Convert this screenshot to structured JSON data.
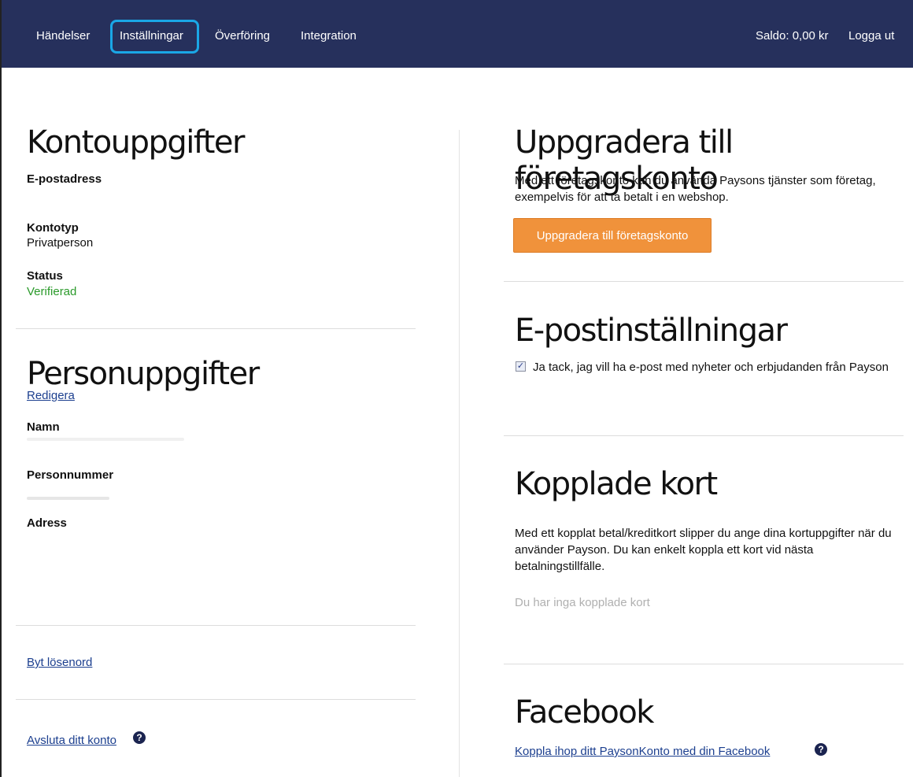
{
  "nav": {
    "items": [
      "Händelser",
      "Inställningar",
      "Överföring",
      "Integration"
    ],
    "balance": "Saldo: 0,00 kr",
    "logout": "Logga ut"
  },
  "account": {
    "title": "Kontouppgifter",
    "email_label": "E-postadress",
    "type_label": "Kontotyp",
    "type_value": "Privatperson",
    "status_label": "Status",
    "status_value": "Verifierad"
  },
  "personal": {
    "title": "Personuppgifter",
    "edit_link": "Redigera",
    "name_label": "Namn",
    "ssn_label": "Personnummer",
    "address_label": "Adress"
  },
  "links": {
    "change_password": "Byt lösenord",
    "close_account": "Avsluta ditt konto"
  },
  "upgrade": {
    "title": "Uppgradera till företagskonto",
    "text": "Med ett företagskonto kan du använda Paysons tjänster som företag, exempelvis för att ta betalt i en webshop.",
    "button": "Uppgradera till företagskonto"
  },
  "email_settings": {
    "title": "E-postinställningar",
    "checkbox_label": "Ja tack, jag vill ha e-post med nyheter och erbjudanden från Payson"
  },
  "cards": {
    "title": "Kopplade kort",
    "text": "Med ett kopplat betal/kreditkort slipper du ange dina kortuppgifter när du använder Payson. Du kan enkelt koppla ett kort vid nästa betalningstillfälle.",
    "empty": "Du har inga kopplade kort"
  },
  "facebook": {
    "title": "Facebook",
    "link": "Koppla ihop ditt PaysonKonto med din Facebook"
  },
  "colors": {
    "nav_bg": "#26305c",
    "accent_orange": "#f0923b",
    "link_blue": "#1c3f8f",
    "status_green": "#2a9a2a"
  }
}
